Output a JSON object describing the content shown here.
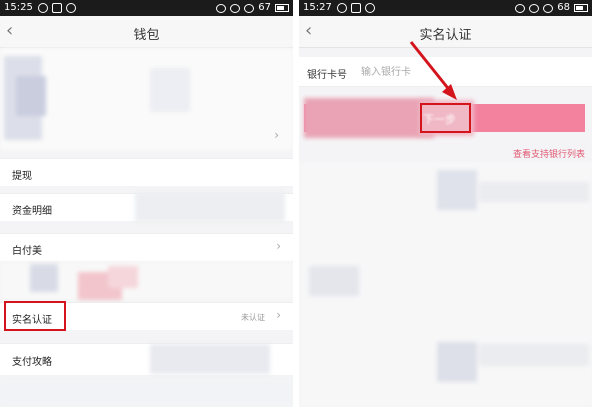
{
  "left": {
    "status": {
      "time": "15:25",
      "battery": "67"
    },
    "nav": {
      "back_icon": "‹",
      "title": "钱包"
    },
    "rows": [
      {
        "label": "提现"
      },
      {
        "label": "资金明细"
      },
      {
        "label": "白付美"
      },
      {
        "label": "实名认证",
        "status": "未认证"
      },
      {
        "label": "支付攻略"
      }
    ]
  },
  "right": {
    "status": {
      "time": "15:27",
      "battery": "68"
    },
    "nav": {
      "back_icon": "‹",
      "title": "实名认证"
    },
    "card": {
      "label": "银行卡号",
      "placeholder": "输入银行卡"
    },
    "next_button": "下一步",
    "support_link": "查看支持银行列表"
  },
  "chevron": "›",
  "colors": {
    "accent_pink": "#f3829f",
    "highlight_red": "#d4141c",
    "link_red": "#e05872"
  }
}
